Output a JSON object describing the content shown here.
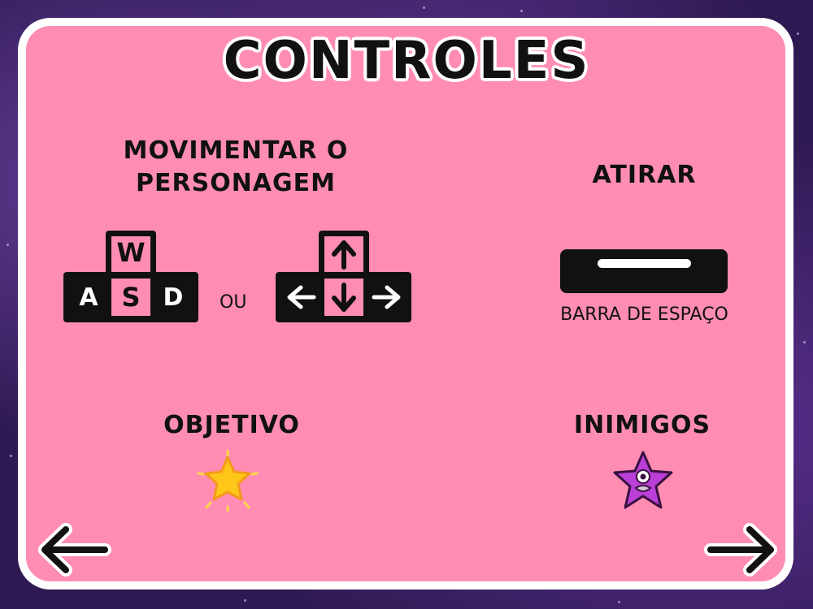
{
  "screen": {
    "title": "CONTROLES",
    "move": {
      "heading_line1": "MOVIMENTAR O",
      "heading_line2": "PERSONAGEM",
      "wasd_keys": {
        "w": "W",
        "a": "A",
        "s": "S",
        "d": "D"
      },
      "or_label": "OU",
      "arrow_icons": [
        "arrow-up-icon",
        "arrow-left-icon",
        "arrow-down-icon",
        "arrow-right-icon"
      ]
    },
    "shoot": {
      "heading": "ATIRAR",
      "key_caption": "BARRA DE ESPAÇO"
    },
    "objective": {
      "heading": "OBJETIVO",
      "icon": "star-icon"
    },
    "enemies": {
      "heading": "INIMIGOS",
      "icon": "purple-star-monster-icon"
    },
    "navigation": {
      "back_icon": "arrow-left-icon",
      "next_icon": "arrow-right-icon"
    },
    "colors": {
      "panel": "#ff8db3",
      "border": "#ffffff",
      "key": "#111111",
      "star": "#ffc61a",
      "enemy": "#b93fd6"
    }
  }
}
